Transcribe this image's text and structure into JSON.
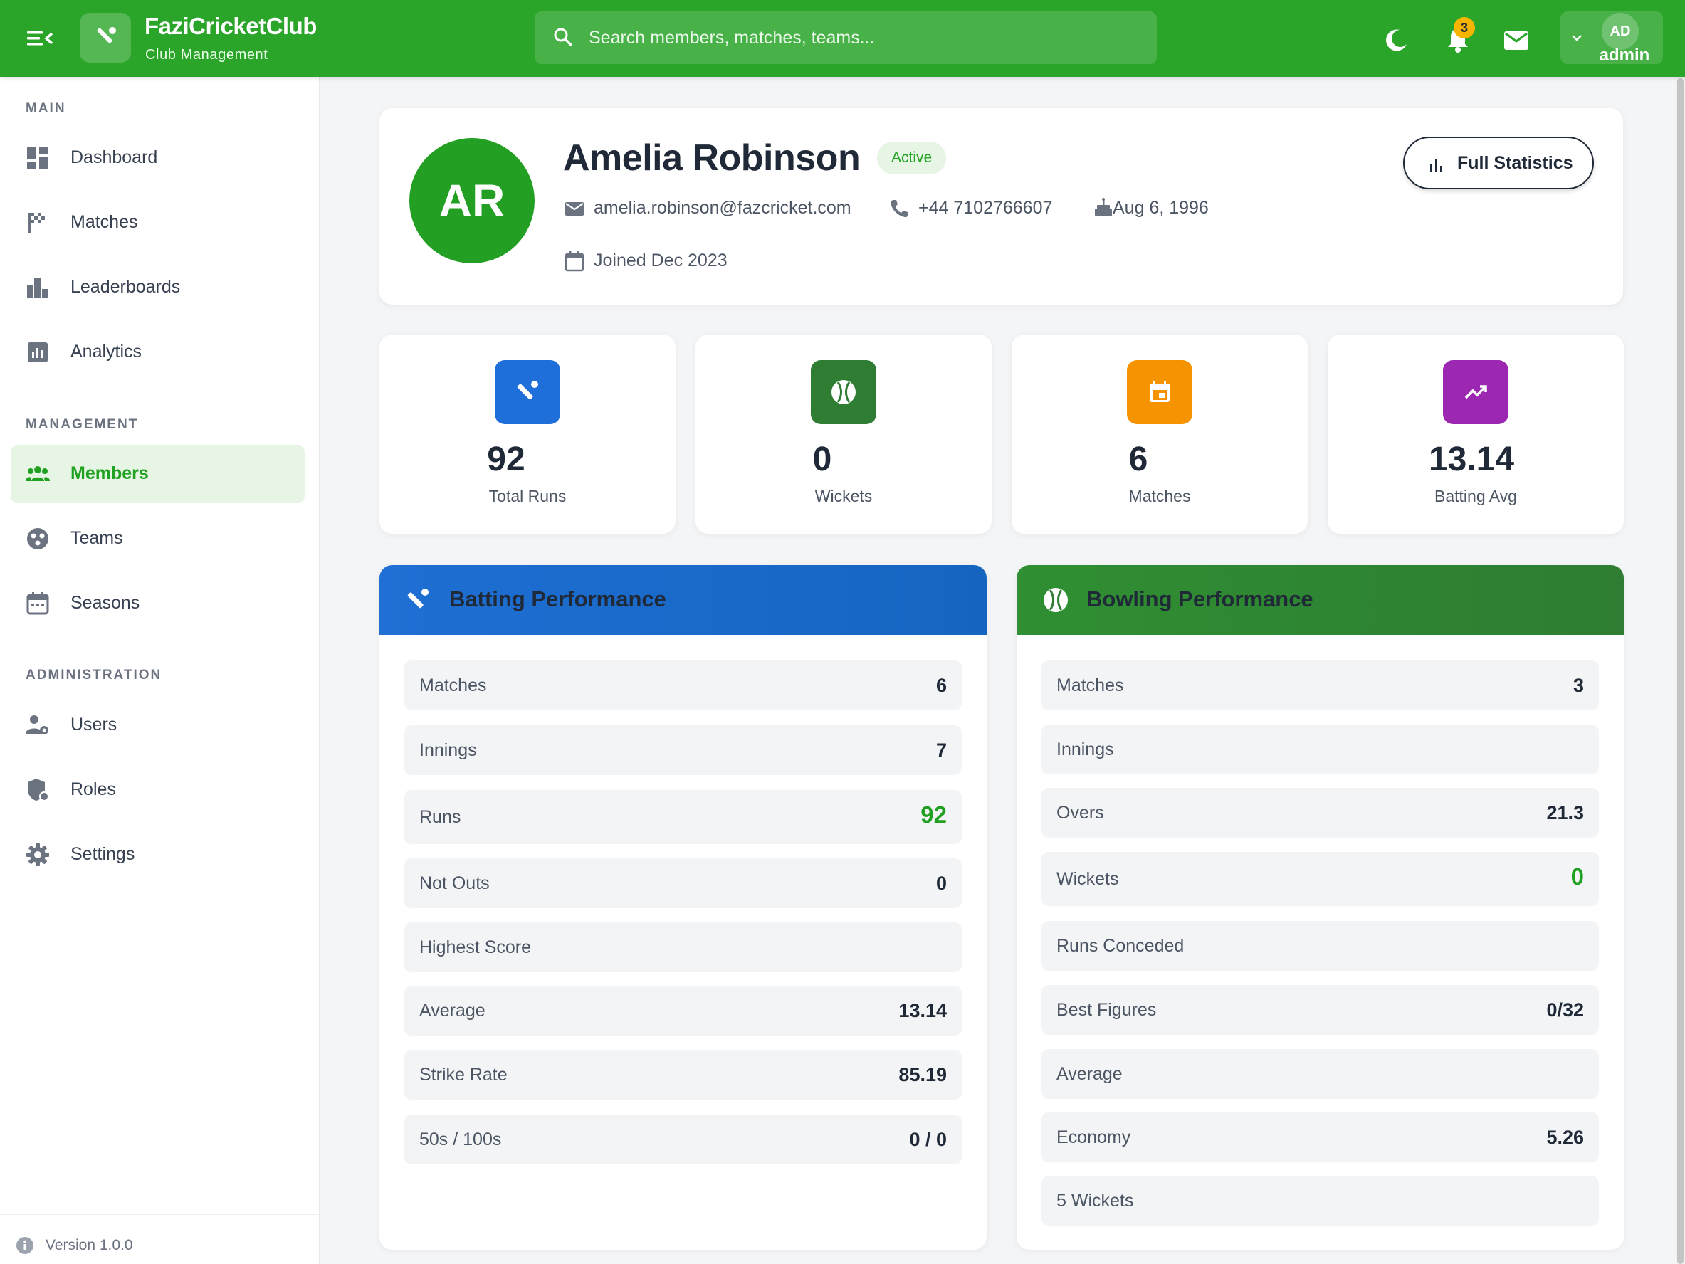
{
  "brand": {
    "name": "FaziCricketClub",
    "subtitle": "Club Management"
  },
  "search": {
    "placeholder": "Search members, matches, teams..."
  },
  "topbar": {
    "icons": [
      "menu-toggle-icon",
      "moon-icon",
      "bell-icon",
      "mail-icon",
      "chevron-down-icon"
    ],
    "notifications_count": "3",
    "user_initials": "AD",
    "user_name": "admin"
  },
  "sidebar": {
    "sections": [
      {
        "label": "MAIN",
        "items": [
          {
            "label": "Dashboard",
            "icon": "dashboard-icon"
          },
          {
            "label": "Matches",
            "icon": "flag-icon"
          },
          {
            "label": "Leaderboards",
            "icon": "leaderboard-icon"
          },
          {
            "label": "Analytics",
            "icon": "analytics-icon"
          }
        ]
      },
      {
        "label": "MANAGEMENT",
        "items": [
          {
            "label": "Members",
            "icon": "group-icon",
            "active": true
          },
          {
            "label": "Teams",
            "icon": "teams-icon"
          },
          {
            "label": "Seasons",
            "icon": "calendar-icon"
          }
        ]
      },
      {
        "label": "ADMINISTRATION",
        "items": [
          {
            "label": "Users",
            "icon": "user-settings-icon"
          },
          {
            "label": "Roles",
            "icon": "shield-icon"
          },
          {
            "label": "Settings",
            "icon": "gear-icon"
          }
        ]
      }
    ],
    "version": "Version 1.0.0"
  },
  "profile": {
    "initials": "AR",
    "name": "Amelia Robinson",
    "status": "Active",
    "email": "amelia.robinson@fazcricket.com",
    "phone": "+44 7102766607",
    "dob": "Aug 6, 1996",
    "joined": "Joined Dec 2023",
    "full_stats_label": "Full Statistics"
  },
  "stats": [
    {
      "value": "92",
      "label": "Total Runs",
      "icon": "cricket-bat-icon",
      "color": "#1e6fd9"
    },
    {
      "value": "0",
      "label": "Wickets",
      "icon": "cricket-ball-icon",
      "color": "#2e7d32"
    },
    {
      "value": "6",
      "label": "Matches",
      "icon": "event-icon",
      "color": "#f59300"
    },
    {
      "value": "13.14",
      "label": "Batting Avg",
      "icon": "trending-up-icon",
      "color": "#9c27b0"
    }
  ],
  "batting": {
    "title": "Batting Performance",
    "rows": [
      {
        "label": "Matches",
        "value": "6"
      },
      {
        "label": "Innings",
        "value": "7"
      },
      {
        "label": "Runs",
        "value": "92"
      },
      {
        "label": "Not Outs",
        "value": "0"
      },
      {
        "label": "Highest Score",
        "value": ""
      },
      {
        "label": "Average",
        "value": "13.14"
      },
      {
        "label": "Strike Rate",
        "value": "85.19"
      },
      {
        "label": "50s / 100s",
        "value": "0 / 0"
      }
    ]
  },
  "bowling": {
    "title": "Bowling Performance",
    "rows": [
      {
        "label": "Matches",
        "value": "3"
      },
      {
        "label": "Innings",
        "value": ""
      },
      {
        "label": "Overs",
        "value": "21.3"
      },
      {
        "label": "Wickets",
        "value": "0"
      },
      {
        "label": "Runs Conceded",
        "value": ""
      },
      {
        "label": "Best Figures",
        "value": "0/32"
      },
      {
        "label": "Average",
        "value": ""
      },
      {
        "label": "Economy",
        "value": "5.26"
      },
      {
        "label": "5 Wickets",
        "value": ""
      }
    ]
  },
  "colors": {
    "brand_green": "#2aa52a",
    "accent_green": "#21a121",
    "batting_blue": "#1565c0",
    "bowling_green": "#2e7d32"
  }
}
